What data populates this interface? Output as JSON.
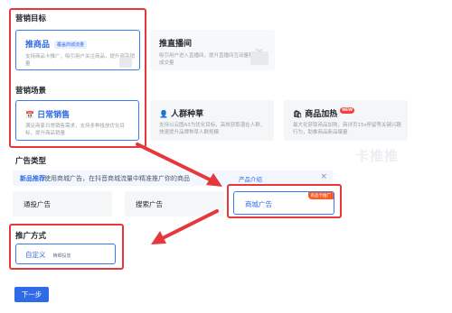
{
  "sections": {
    "goal_title": "营销目标",
    "scene_title": "营销场景",
    "ad_type_title": "广告类型",
    "promo_method_title": "推广方式"
  },
  "goal_cards": [
    {
      "title": "推商品",
      "tag": "覆盖商城流量",
      "desc": "支持商品卡推广，吸引用户关注商品，提升商品销量"
    },
    {
      "title": "推直播间",
      "desc": "吸引用户进入直播间，提升直播间互动量和成交量"
    }
  ],
  "scene_cards": [
    {
      "title": "日常销售",
      "desc": "满足商家日常销售需求，支持多种投放优化目标，提升商品销量"
    },
    {
      "title": "人群种草",
      "desc": "支持以云图A3为优化目标，高效获取潜在人群，快速提升品牌种草人群规模"
    },
    {
      "title": "商品加热",
      "badge": "NEW",
      "desc": "最大化获取商品加购，商详页15s停留等关键兴趣行为，助推商品新品爆量"
    }
  ],
  "info_bar": {
    "lead": "新品推荐",
    "text": "使用商城广告，在抖音商城流量中精准推广你的商品",
    "link": "产品介绍",
    "close": "×"
  },
  "ad_types": [
    {
      "label": "通投广告"
    },
    {
      "label": "搜索广告"
    },
    {
      "label": "商城广告",
      "badge": "商品卡推广"
    }
  ],
  "promo_method": {
    "label": "自定义",
    "tag": "精细投放"
  },
  "next_button": "下一步",
  "watermark": "卡推推",
  "colors": {
    "accent": "#2f6be6",
    "annotation": "#e5383b"
  }
}
